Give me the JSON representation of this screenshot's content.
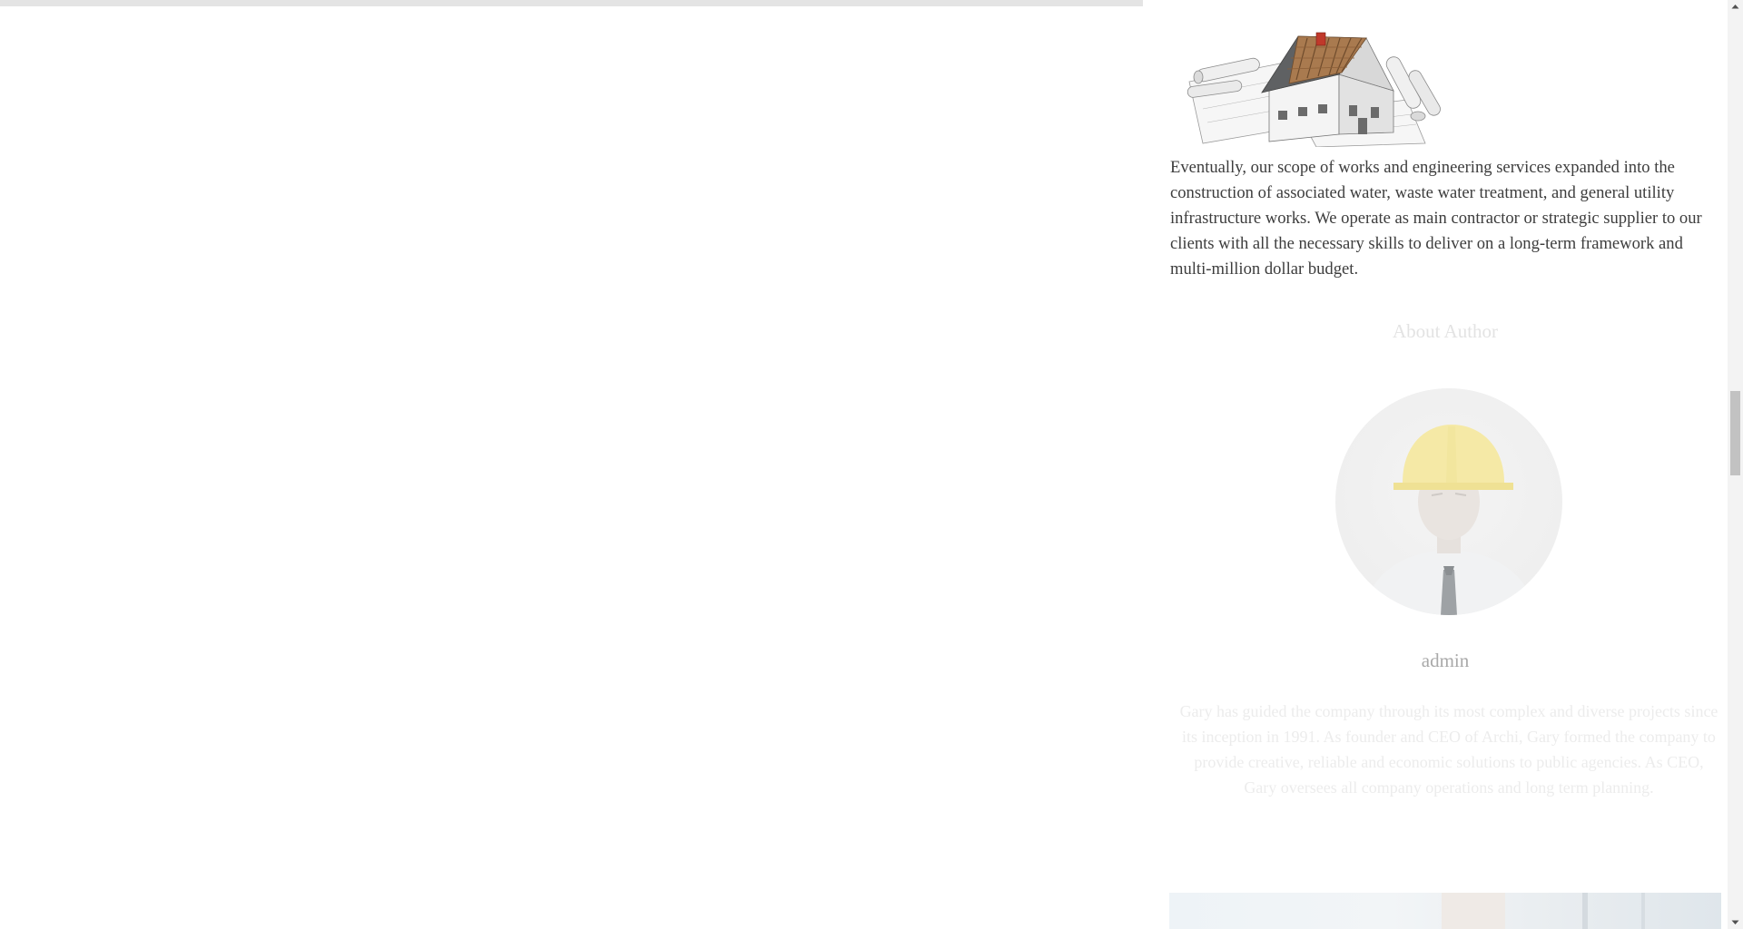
{
  "article": {
    "body_text": "Eventually, our scope of works and engineering services expanded into the construction of associated water, waste water treatment, and general utility infrastructure works. We operate as main contractor or strategic supplier to our clients with all the necessary skills to deliver on a long-term framework and multi-million dollar budget."
  },
  "about_author": {
    "heading": "About Author",
    "name": "admin",
    "bio": "Gary has guided the company through its most complex and diverse projects since its inception in 1991. As founder and CEO of Archi, Gary formed the company to provide creative, reliable and economic solutions to public agencies. As CEO, Gary oversees all company operations and long term planning."
  },
  "icons": {
    "scroll_up": "scroll-up-arrow-icon",
    "scroll_down": "scroll-down-arrow-icon"
  },
  "colors": {
    "body_text": "#3d3d3d",
    "heading_faded": "#e3e3e3",
    "name_text": "#a9a9a9",
    "bio_faded": "#ececec",
    "scroll_thumb": "#c2c2c2"
  }
}
